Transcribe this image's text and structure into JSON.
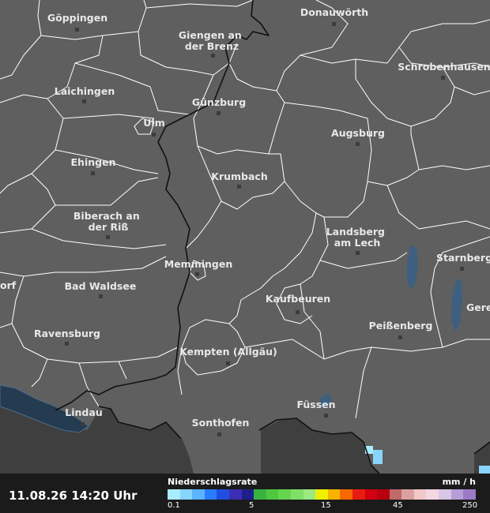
{
  "timestamp": "11.08.26 14:20 Uhr",
  "legend": {
    "title": "Niederschlagsrate",
    "unit": "mm / h",
    "ticks": [
      "0.1",
      "5",
      "15",
      "45",
      "250"
    ],
    "colors": [
      "#a9ecff",
      "#87d4ff",
      "#5bb4ff",
      "#2a7cff",
      "#1f4fe0",
      "#3b2db4",
      "#1f1f8c",
      "#38b341",
      "#4fc63f",
      "#66d44c",
      "#80df66",
      "#9aea80",
      "#eef000",
      "#f9b200",
      "#f86800",
      "#e81b10",
      "#d20010",
      "#b80010",
      "#c06a6a",
      "#dba0a0",
      "#f0c8c8",
      "#f2d6e2",
      "#d8c6e6",
      "#b79cd6",
      "#9a7ac6"
    ]
  },
  "cities": [
    {
      "id": "goeppingen",
      "lines": [
        "Göppingen"
      ]
    },
    {
      "id": "giengen",
      "lines": [
        "Giengen an",
        "der Brenz"
      ]
    },
    {
      "id": "donauwoerth",
      "lines": [
        "Donauwörth"
      ]
    },
    {
      "id": "schrobenhausen",
      "lines": [
        "Schrobenhausen"
      ]
    },
    {
      "id": "laichingen",
      "lines": [
        "Laichingen"
      ]
    },
    {
      "id": "guenzburg",
      "lines": [
        "Günzburg"
      ]
    },
    {
      "id": "ulm",
      "lines": [
        "Ulm"
      ]
    },
    {
      "id": "augsburg",
      "lines": [
        "Augsburg"
      ]
    },
    {
      "id": "ehingen",
      "lines": [
        "Ehingen"
      ]
    },
    {
      "id": "krumbach",
      "lines": [
        "Krumbach"
      ]
    },
    {
      "id": "biberach",
      "lines": [
        "Biberach an",
        "der Riß"
      ]
    },
    {
      "id": "landsberg",
      "lines": [
        "Landsberg",
        "am Lech"
      ]
    },
    {
      "id": "starnberg",
      "lines": [
        "Starnberg"
      ]
    },
    {
      "id": "memmingen",
      "lines": [
        "Memmingen"
      ]
    },
    {
      "id": "orf",
      "lines": [
        "orf"
      ]
    },
    {
      "id": "bad-waldsee",
      "lines": [
        "Bad Waldsee"
      ]
    },
    {
      "id": "kaufbeuren",
      "lines": [
        "Kaufbeuren"
      ]
    },
    {
      "id": "gere",
      "lines": [
        "Gere"
      ]
    },
    {
      "id": "peissenberg",
      "lines": [
        "Peißenberg"
      ]
    },
    {
      "id": "ravensburg",
      "lines": [
        "Ravensburg"
      ]
    },
    {
      "id": "kempten",
      "lines": [
        "Kempten (Allgäu)"
      ]
    },
    {
      "id": "fuessen",
      "lines": [
        "Füssen"
      ]
    },
    {
      "id": "lindau",
      "lines": [
        "Lindau"
      ]
    },
    {
      "id": "sonthofen",
      "lines": [
        "Sonthofen"
      ]
    }
  ]
}
